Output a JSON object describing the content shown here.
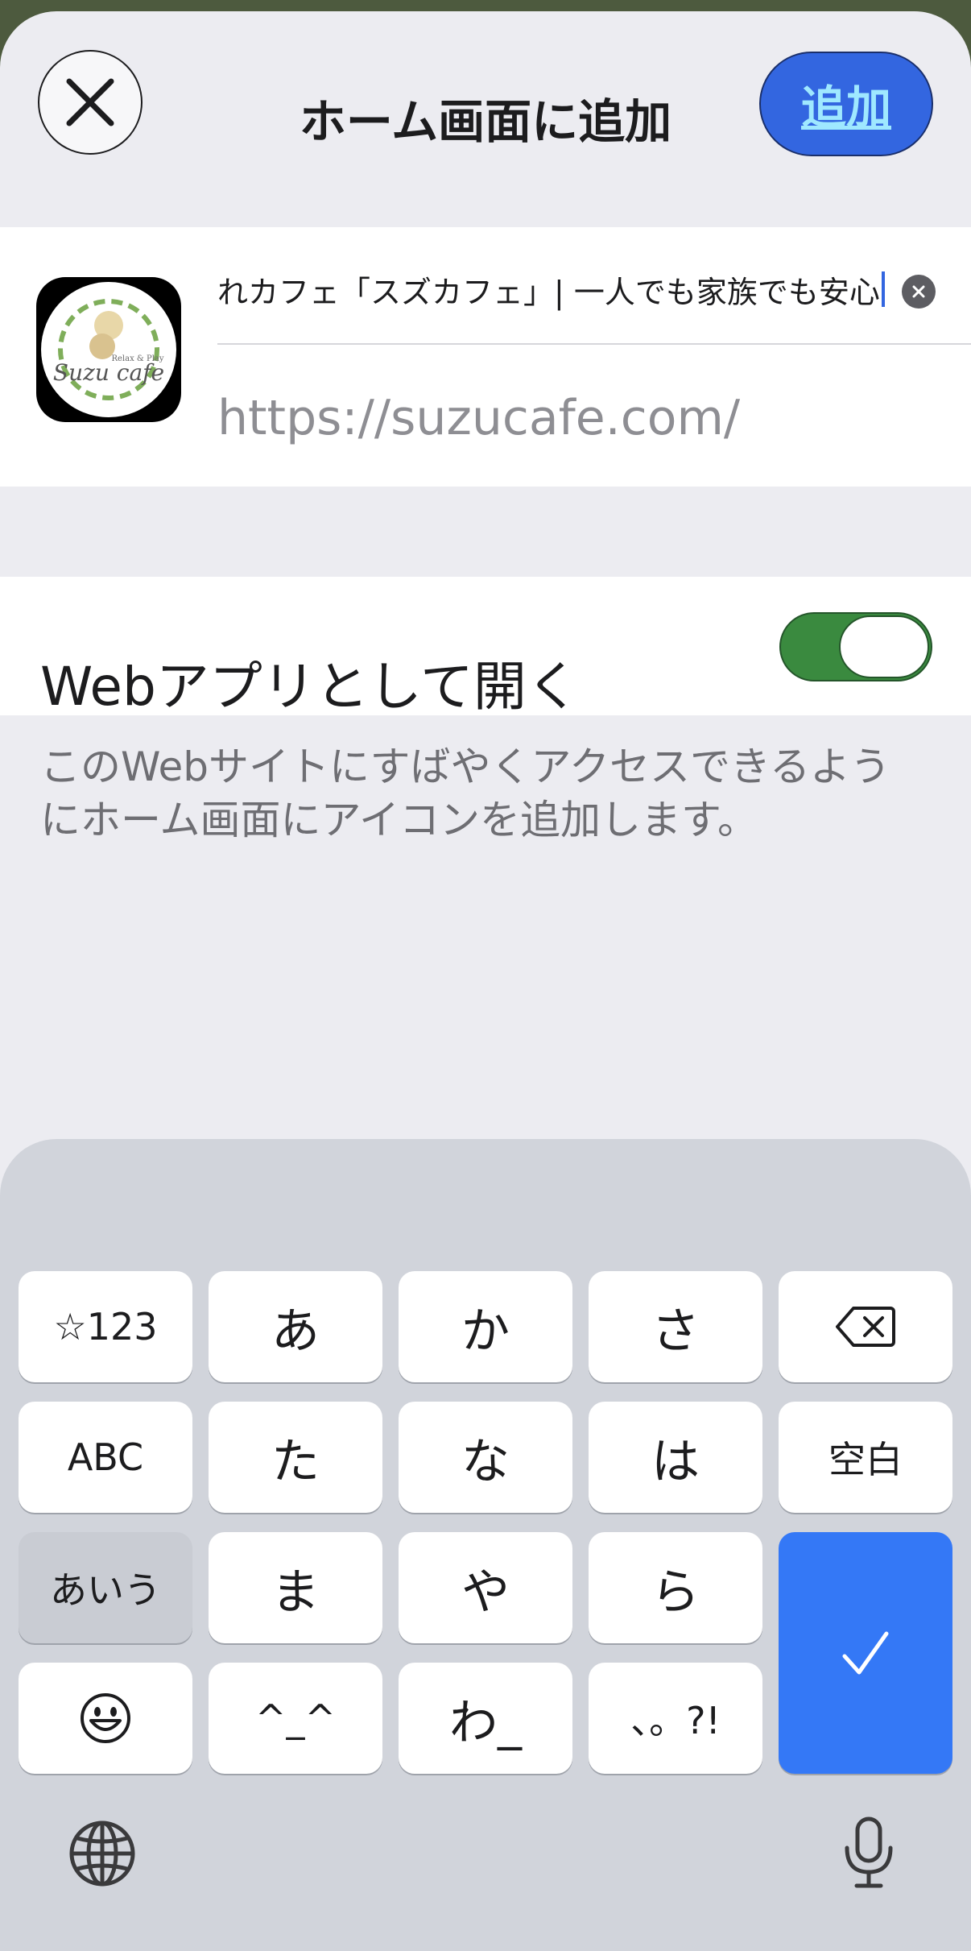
{
  "header": {
    "title": "ホーム画面に追加",
    "add_label": "追加"
  },
  "site": {
    "name_value": "れカフェ「スズカフェ」| 一人でも家族でも安心",
    "url": "https://suzucafe.com/",
    "icon_text_top": "Relax & Play",
    "icon_text_main": "Suzu cafe"
  },
  "webapp": {
    "label": "Webアプリとして開く",
    "toggle_on": true
  },
  "description": "このWebサイトにすばやくアクセスできるようにホーム画面にアイコンを追加します。",
  "keyboard": {
    "keys": {
      "sym": "☆123",
      "a": "あ",
      "ka": "か",
      "sa": "さ",
      "abc": "ABC",
      "ta": "た",
      "na": "な",
      "ha": "は",
      "space": "空白",
      "aiu": "あいう",
      "ma": "ま",
      "ya": "や",
      "ra": "ら",
      "emoji": "☺",
      "kaomoji": "^_^",
      "wa": "わ_",
      "punct": "、。?!"
    },
    "colors": {
      "accent": "#3478f6",
      "toggle": "#3a8a3f"
    }
  }
}
